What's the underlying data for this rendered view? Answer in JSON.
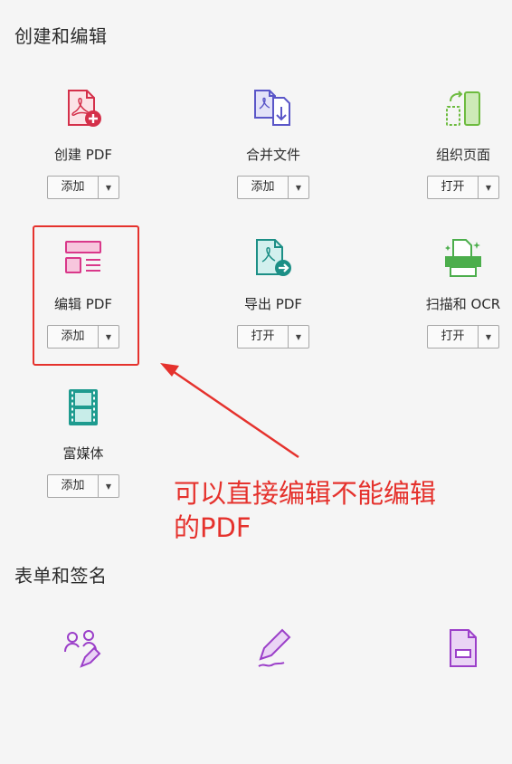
{
  "sections": {
    "create_edit": "创建和编辑",
    "forms_sign": "表单和签名"
  },
  "tools": {
    "create_pdf": {
      "label": "创建 PDF",
      "button": "添加"
    },
    "combine": {
      "label": "合并文件",
      "button": "添加"
    },
    "organize": {
      "label": "组织页面",
      "button": "打开"
    },
    "edit_pdf": {
      "label": "编辑 PDF",
      "button": "添加"
    },
    "export_pdf": {
      "label": "导出 PDF",
      "button": "打开"
    },
    "scan_ocr": {
      "label": "扫描和 OCR",
      "button": "打开"
    },
    "rich_media": {
      "label": "富媒体",
      "button": "添加"
    }
  },
  "annotation": {
    "line1": "可以直接编辑不能编辑",
    "line2": "的PDF",
    "color": "#e5322d"
  },
  "icons": {
    "create_pdf": "create-pdf-icon",
    "combine": "combine-files-icon",
    "organize": "organize-pages-icon",
    "edit_pdf": "edit-pdf-icon",
    "export_pdf": "export-pdf-icon",
    "scan_ocr": "scan-ocr-icon",
    "rich_media": "rich-media-icon",
    "request_sign": "request-signature-icon",
    "fill_sign": "fill-sign-icon",
    "prepare_form": "prepare-form-icon"
  }
}
